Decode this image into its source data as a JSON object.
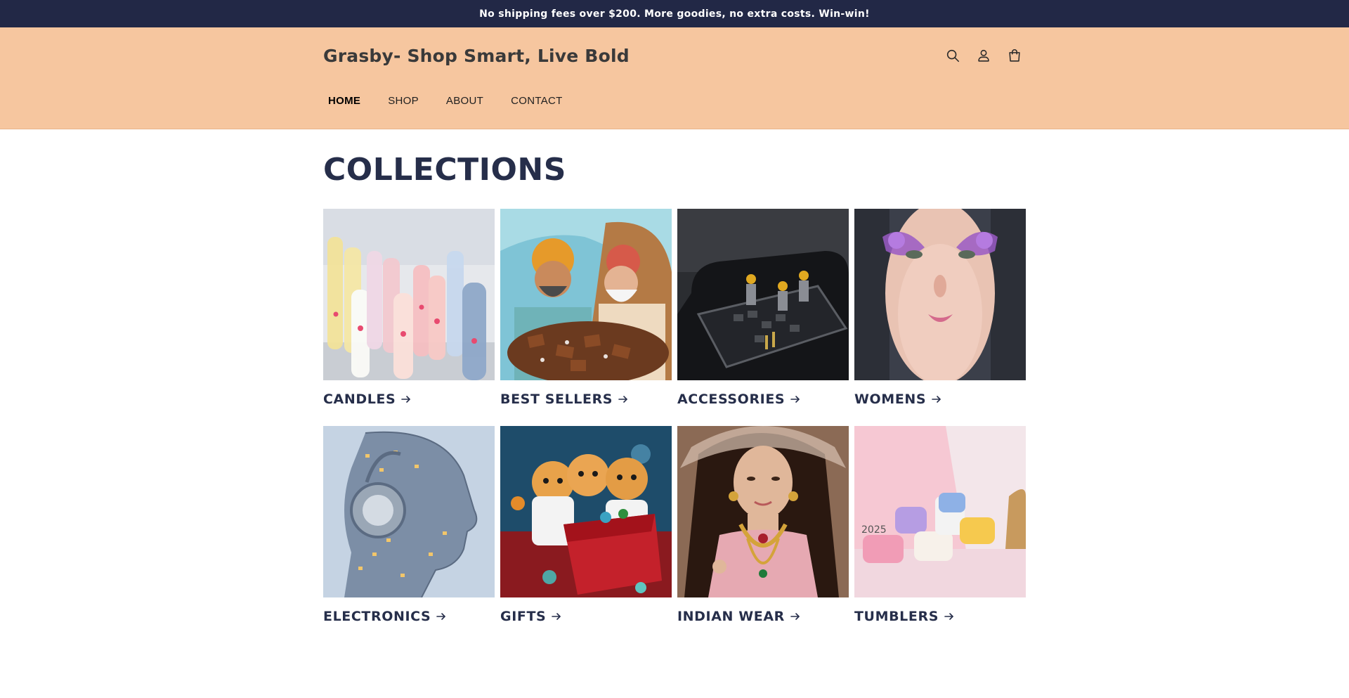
{
  "announcement": {
    "text": "No shipping fees over $200. More goodies, no extra costs. Win-win!"
  },
  "header": {
    "brand": "Grasby- Shop Smart, Live Bold",
    "icons": [
      "search-icon",
      "account-icon",
      "cart-icon"
    ],
    "nav": [
      {
        "label": "HOME",
        "active": true
      },
      {
        "label": "SHOP",
        "active": false
      },
      {
        "label": "ABOUT",
        "active": false
      },
      {
        "label": "CONTACT",
        "active": false
      }
    ]
  },
  "main": {
    "title": "COLLECTIONS",
    "collections": [
      {
        "name": "CANDLES",
        "image": "pastel-cat-candles"
      },
      {
        "name": "BEST SELLERS",
        "image": "men-with-chocolates"
      },
      {
        "name": "ACCESSORIES",
        "image": "workers-on-smartwatch"
      },
      {
        "name": "WOMENS",
        "image": "woman-purple-makeup"
      },
      {
        "name": "ELECTRONICS",
        "image": "headphone-city-head"
      },
      {
        "name": "GIFTS",
        "image": "kittens-gift-box"
      },
      {
        "name": "INDIAN WEAR",
        "image": "woman-indian-jewelry"
      },
      {
        "name": "TUMBLERS",
        "image": "pastel-tumbler-toys"
      }
    ]
  },
  "colors": {
    "announcement_bg": "#222846",
    "header_bg": "#f6c69f",
    "title": "#262e4a"
  }
}
